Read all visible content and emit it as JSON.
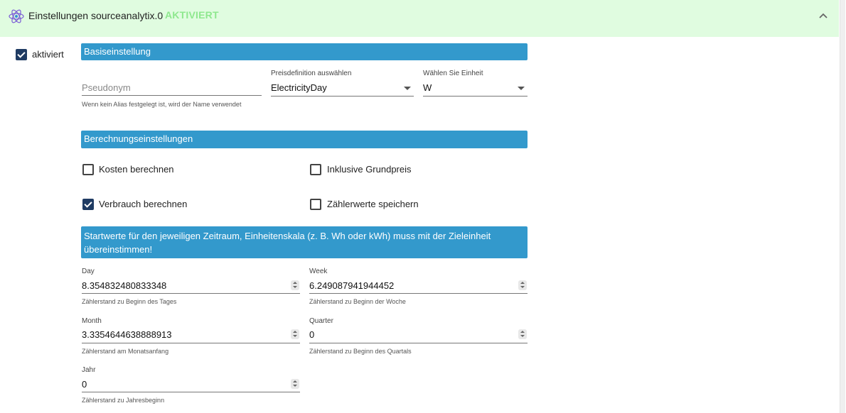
{
  "header": {
    "title": "Einstellungen sourceanalytix.0",
    "status": "AKTIVIERT",
    "logo_icon": "atom-icon",
    "collapse_icon": "chevron-up-icon"
  },
  "enabled": {
    "label": "aktiviert",
    "checked": true
  },
  "sections": {
    "basic": "Basiseinstellung",
    "calc": "Berechnungseinstellungen",
    "start": "Startwerte für den jeweiligen Zeitraum, Einheitenskala (z. B. Wh oder kWh) muss mit der Zieleinheit übereinstimmen!"
  },
  "basic": {
    "alias": {
      "placeholder": "Pseudonym",
      "helper": "Wenn kein Alias festgelegt ist, wird der Name verwendet"
    },
    "price": {
      "label": "Preisdefinition auswählen",
      "value": "ElectricityDay"
    },
    "unit": {
      "label": "Wählen Sie Einheit",
      "value": "W"
    }
  },
  "calc": {
    "cost": {
      "label": "Kosten berechnen",
      "checked": false
    },
    "basePrice": {
      "label": "Inklusive Grundpreis",
      "checked": false
    },
    "consumption": {
      "label": "Verbrauch berechnen",
      "checked": true
    },
    "meterValues": {
      "label": "Zählerwerte speichern",
      "checked": false
    }
  },
  "start": {
    "day": {
      "label": "Day",
      "value": "8.354832480833348",
      "helper": "Zählerstand zu Beginn des Tages"
    },
    "week": {
      "label": "Week",
      "value": "6.249087941944452",
      "helper": "Zählerstand zu Beginn der Woche"
    },
    "month": {
      "label": "Month",
      "value": "3.3354644638888913",
      "helper": "Zählerstand am Monatsanfang"
    },
    "quarter": {
      "label": "Quarter",
      "value": "0",
      "helper": "Zählerstand zu Beginn des Quartals"
    },
    "year": {
      "label": "Jahr",
      "value": "0",
      "helper": "Zählerstand zu Jahresbeginn"
    }
  },
  "colors": {
    "header_bg": "#e0fce0",
    "status": "#8ee88e",
    "section_bar": "#3399cc",
    "checkbox": "#1f3b63"
  }
}
